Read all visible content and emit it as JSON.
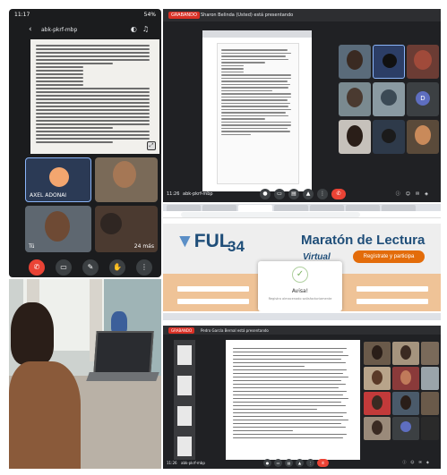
{
  "phone": {
    "status_time": "11:17",
    "status_right": "54%",
    "meeting_code": "abk-pkrf-mbp",
    "tiles": [
      {
        "name": "AXEL ADONAI"
      },
      {
        "name": ""
      },
      {
        "name": ""
      },
      {
        "name": ""
      },
      {
        "name": "Tú"
      },
      {
        "name": "24 más"
      }
    ]
  },
  "meet1": {
    "rec_label": "GRABANDO",
    "banner_text": "Sharon Belinda (Usted) está presentando",
    "grid_tiles": [
      {
        "name": ""
      },
      {
        "name": ""
      },
      {
        "name": ""
      },
      {
        "name": ""
      },
      {
        "name": ""
      },
      {
        "name": ""
      },
      {
        "name": ""
      },
      {
        "name": ""
      },
      {
        "name": ""
      }
    ],
    "bottom_time": "11:26",
    "bottom_code": "abk-pkrf-mbp",
    "accent_red": "#ea4335"
  },
  "web": {
    "logo": "FUL",
    "logo_number": "34",
    "title": "Maratón de Lectura",
    "subtitle": "Virtual",
    "register_button": "Regístrate y participa",
    "modal_title": "Avisa!",
    "modal_subtitle": "Registro almacenado satisfactoriamente",
    "brand_blue": "#1f4e79",
    "brand_orange": "#e36c0a"
  },
  "meet2": {
    "rec_label": "GRABANDO",
    "banner_text": "Pedro García Bernal está presentando",
    "bottom_time": "11:26",
    "bottom_code": "abk-pkrf-mbp"
  }
}
